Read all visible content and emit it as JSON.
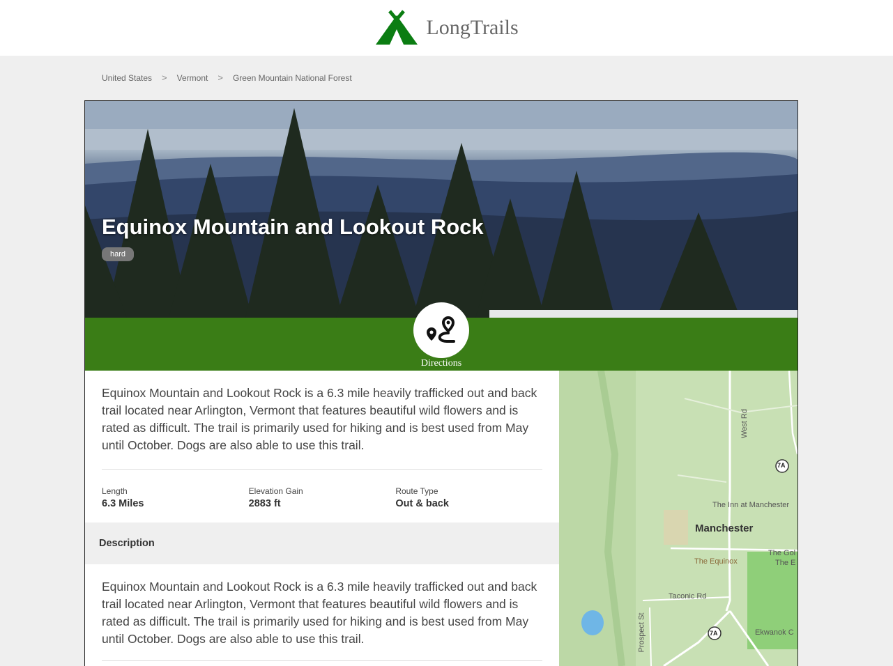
{
  "brand": {
    "name": "LongTrails",
    "color": "#0b7d12"
  },
  "breadcrumb": [
    "United States",
    "Vermont",
    "Green Mountain National Forest"
  ],
  "breadcrumb_sep": ">",
  "trail": {
    "title": "Equinox Mountain and Lookout Rock",
    "difficulty": "hard",
    "summary": "Equinox Mountain and Lookout Rock is a 6.3 mile heavily trafficked out and back trail located near Arlington, Vermont that features beautiful wild flowers and is rated as difficult. The trail is primarily used for hiking and is best used from May until October. Dogs are also able to use this trail.",
    "directions_label": "Directions",
    "stats": [
      {
        "label": "Length",
        "value": "6.3 Miles"
      },
      {
        "label": "Elevation Gain",
        "value": "2883 ft"
      },
      {
        "label": "Route Type",
        "value": "Out & back"
      }
    ],
    "description_heading": "Description",
    "description": "Equinox Mountain and Lookout Rock is a 6.3 mile heavily trafficked out and back trail located near Arlington, Vermont that features beautiful wild flowers and is rated as difficult. The trail is primarily used for hiking and is best used from May until October. Dogs are also able to use this trail."
  },
  "map": {
    "town": "Manchester",
    "labels": {
      "west_rd": "West Rd",
      "route_7a": "7A",
      "inn": "The Inn at Manchester",
      "equinox": "The Equinox",
      "taconic": "Taconic Rd",
      "prospect": "Prospect St",
      "golf": "The Gol",
      "the_e": "The E",
      "ekwanok": "Ekwanok C"
    }
  },
  "colors": {
    "accent_green": "#3a7d16",
    "badge": "#777777"
  }
}
